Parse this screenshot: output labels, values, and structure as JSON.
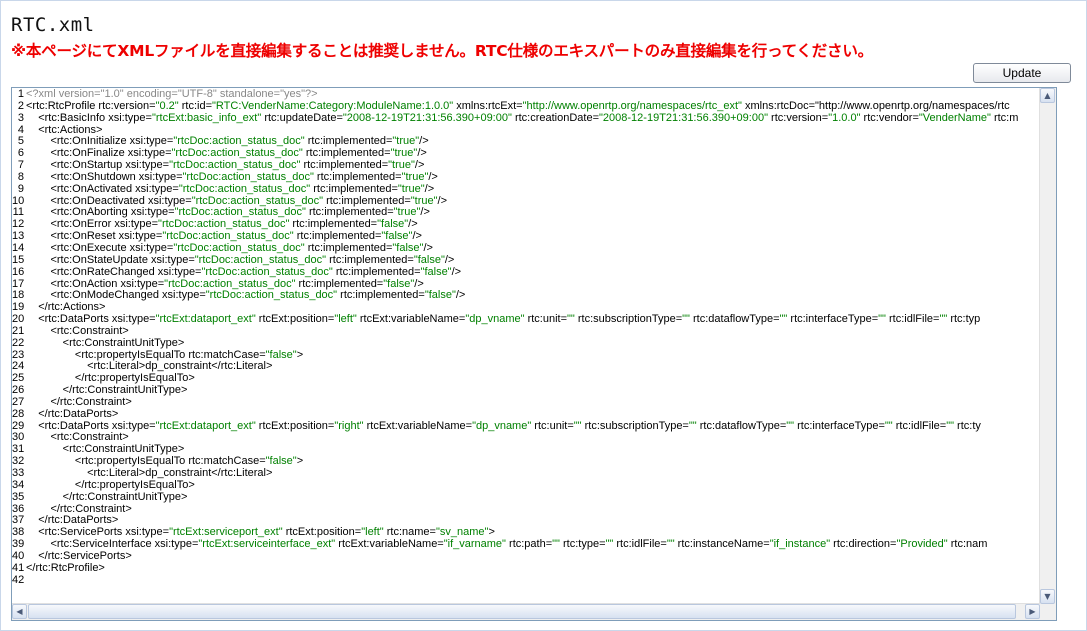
{
  "page": {
    "title": "RTC.xml",
    "warning": "※本ページにてXMLファイルを直接編集することは推奨しません。RTC仕様のエキスパートのみ直接編集を行ってください。",
    "update_label": "Update"
  },
  "colors": {
    "warning": "#ee0000",
    "string": "#008000",
    "declaration": "#888888",
    "border": "#7f9db9"
  },
  "icons": {
    "scroll_up": "triangle-up",
    "scroll_down": "triangle-down",
    "scroll_left": "triangle-left",
    "scroll_right": "triangle-right"
  },
  "editor": {
    "lines": [
      "<?xml version=\"1.0\" encoding=\"UTF-8\" standalone=\"yes\"?>",
      "<rtc:RtcProfile rtc:version=\"0.2\" rtc:id=\"RTC:VenderName:Category:ModuleName:1.0.0\" xmlns:rtcExt=\"http://www.openrtp.org/namespaces/rtc_ext\" xmlns:rtcDoc=\"http://www.openrtp.org/namespaces/rtc",
      "    <rtc:BasicInfo xsi:type=\"rtcExt:basic_info_ext\" rtc:updateDate=\"2008-12-19T21:31:56.390+09:00\" rtc:creationDate=\"2008-12-19T21:31:56.390+09:00\" rtc:version=\"1.0.0\" rtc:vendor=\"VenderName\" rtc:m",
      "    <rtc:Actions>",
      "        <rtc:OnInitialize xsi:type=\"rtcDoc:action_status_doc\" rtc:implemented=\"true\"/>",
      "        <rtc:OnFinalize xsi:type=\"rtcDoc:action_status_doc\" rtc:implemented=\"true\"/>",
      "        <rtc:OnStartup xsi:type=\"rtcDoc:action_status_doc\" rtc:implemented=\"true\"/>",
      "        <rtc:OnShutdown xsi:type=\"rtcDoc:action_status_doc\" rtc:implemented=\"true\"/>",
      "        <rtc:OnActivated xsi:type=\"rtcDoc:action_status_doc\" rtc:implemented=\"true\"/>",
      "        <rtc:OnDeactivated xsi:type=\"rtcDoc:action_status_doc\" rtc:implemented=\"true\"/>",
      "        <rtc:OnAborting xsi:type=\"rtcDoc:action_status_doc\" rtc:implemented=\"true\"/>",
      "        <rtc:OnError xsi:type=\"rtcDoc:action_status_doc\" rtc:implemented=\"false\"/>",
      "        <rtc:OnReset xsi:type=\"rtcDoc:action_status_doc\" rtc:implemented=\"false\"/>",
      "        <rtc:OnExecute xsi:type=\"rtcDoc:action_status_doc\" rtc:implemented=\"false\"/>",
      "        <rtc:OnStateUpdate xsi:type=\"rtcDoc:action_status_doc\" rtc:implemented=\"false\"/>",
      "        <rtc:OnRateChanged xsi:type=\"rtcDoc:action_status_doc\" rtc:implemented=\"false\"/>",
      "        <rtc:OnAction xsi:type=\"rtcDoc:action_status_doc\" rtc:implemented=\"false\"/>",
      "        <rtc:OnModeChanged xsi:type=\"rtcDoc:action_status_doc\" rtc:implemented=\"false\"/>",
      "    </rtc:Actions>",
      "    <rtc:DataPorts xsi:type=\"rtcExt:dataport_ext\" rtcExt:position=\"left\" rtcExt:variableName=\"dp_vname\" rtc:unit=\"\" rtc:subscriptionType=\"\" rtc:dataflowType=\"\" rtc:interfaceType=\"\" rtc:idlFile=\"\" rtc:typ",
      "        <rtc:Constraint>",
      "            <rtc:ConstraintUnitType>",
      "                <rtc:propertyIsEqualTo rtc:matchCase=\"false\">",
      "                    <rtc:Literal>dp_constraint</rtc:Literal>",
      "                </rtc:propertyIsEqualTo>",
      "            </rtc:ConstraintUnitType>",
      "        </rtc:Constraint>",
      "    </rtc:DataPorts>",
      "    <rtc:DataPorts xsi:type=\"rtcExt:dataport_ext\" rtcExt:position=\"right\" rtcExt:variableName=\"dp_vname\" rtc:unit=\"\" rtc:subscriptionType=\"\" rtc:dataflowType=\"\" rtc:interfaceType=\"\" rtc:idlFile=\"\" rtc:ty",
      "        <rtc:Constraint>",
      "            <rtc:ConstraintUnitType>",
      "                <rtc:propertyIsEqualTo rtc:matchCase=\"false\">",
      "                    <rtc:Literal>dp_constraint</rtc:Literal>",
      "                </rtc:propertyIsEqualTo>",
      "            </rtc:ConstraintUnitType>",
      "        </rtc:Constraint>",
      "    </rtc:DataPorts>",
      "    <rtc:ServicePorts xsi:type=\"rtcExt:serviceport_ext\" rtcExt:position=\"left\" rtc:name=\"sv_name\">",
      "        <rtc:ServiceInterface xsi:type=\"rtcExt:serviceinterface_ext\" rtcExt:variableName=\"if_varname\" rtc:path=\"\" rtc:type=\"\" rtc:idlFile=\"\" rtc:instanceName=\"if_instance\" rtc:direction=\"Provided\" rtc:nam",
      "    </rtc:ServicePorts>",
      "</rtc:RtcProfile>",
      ""
    ]
  }
}
